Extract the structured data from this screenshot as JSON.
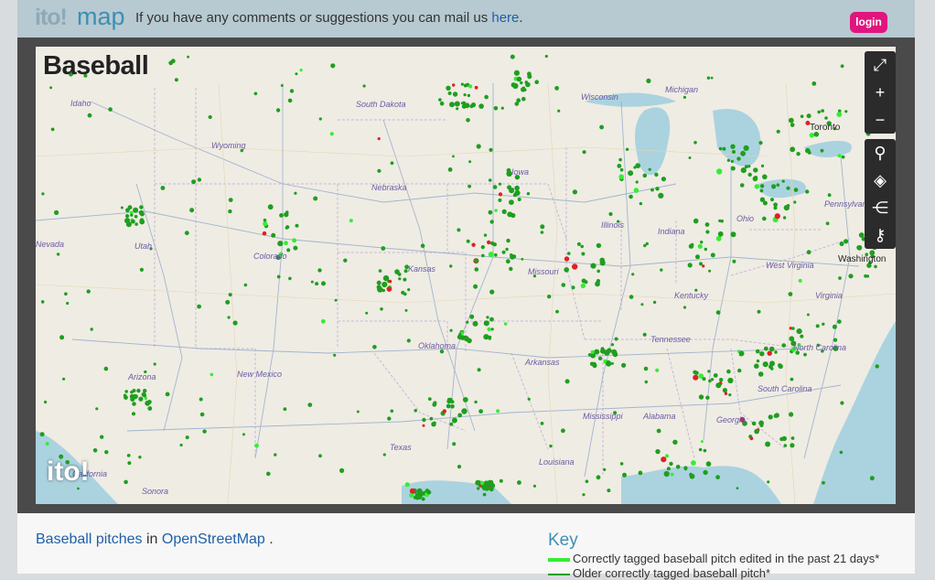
{
  "header": {
    "logo_ito": "ito!",
    "logo_map": "map",
    "message_prefix": "If you have any comments or suggestions you can mail us",
    "message_link": "here",
    "message_suffix": ".",
    "login_label": "login"
  },
  "map": {
    "title": "Baseball",
    "watermark": "ito!",
    "state_labels": [
      "Idaho",
      "South Dakota",
      "Wisconsin",
      "Michigan",
      "Wyoming",
      "Iowa",
      "Nebraska",
      "Illinois",
      "Ohio",
      "Indiana",
      "Utah",
      "Colorado",
      "Kansas",
      "Missouri",
      "West Virginia",
      "Kentucky",
      "Virginia",
      "Oklahoma",
      "Tennessee",
      "North Carolina",
      "Arizona",
      "New Mexico",
      "Arkansas",
      "South Carolina",
      "Mississippi",
      "Alabama",
      "Georgia",
      "Texas",
      "Louisiana",
      "Sonora",
      "Nevada",
      "Pennsylvania",
      "California"
    ],
    "city_labels": [
      "Toronto",
      "Washington"
    ],
    "colors": {
      "recent": "#33ee33",
      "older": "#1f9e1f",
      "error": "#dd2222"
    }
  },
  "toolbar": {
    "group1": [
      {
        "icon": "fullscreen-icon",
        "glyph": "⤢"
      },
      {
        "icon": "zoom-in-icon",
        "glyph": "+"
      },
      {
        "icon": "zoom-out-icon",
        "glyph": "−"
      }
    ],
    "group2": [
      {
        "icon": "search-icon",
        "glyph": "⚲"
      },
      {
        "icon": "layers-icon",
        "glyph": "◈"
      },
      {
        "icon": "share-icon",
        "glyph": "⋲"
      },
      {
        "icon": "key-icon",
        "glyph": "⚷"
      }
    ]
  },
  "footer": {
    "text_link1": "Baseball pitches",
    "text_in": "in",
    "text_link2": "OpenStreetMap",
    "text_suffix": ".",
    "key_title": "Key",
    "key_items": [
      {
        "label": "Correctly tagged baseball pitch edited in the past 21 days*",
        "color": "#33ee33"
      },
      {
        "label": "Older correctly tagged baseball pitch*",
        "color": "#1f9e1f"
      }
    ]
  }
}
